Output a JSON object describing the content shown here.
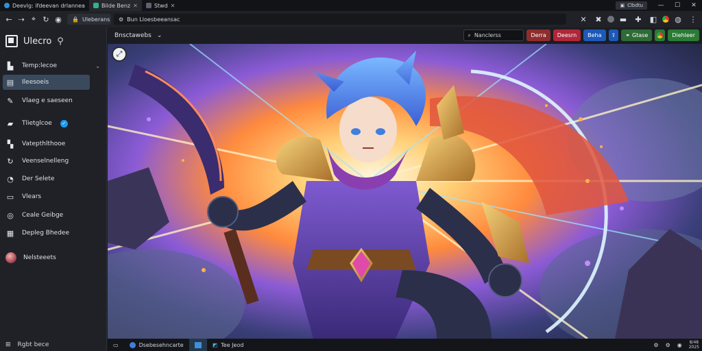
{
  "tabs": [
    {
      "label": "Deevlg: ifdeevan drlannea",
      "active": false
    },
    {
      "label": "Bilde Benz",
      "active": true
    },
    {
      "label": "Stwd",
      "active": false
    }
  ],
  "titlebar": {
    "mini_label": "Clbdtu",
    "mini_icon": "user-icon"
  },
  "address": {
    "short_label": "Uleberans",
    "url": "Bun Lloesbeeansac"
  },
  "sidebar": {
    "brand": "Ulecro",
    "items": [
      {
        "label": "Temp:lecoe",
        "icon": "bookmark-icon",
        "chevron": true
      },
      {
        "label": "Ileesoeis",
        "icon": "document-icon",
        "active": true
      },
      {
        "label": "Vlaeg e saeseen",
        "icon": "pin-icon"
      },
      {
        "label": "Tlietglcoe",
        "icon": "folder-icon",
        "verified": true
      },
      {
        "label": "Vatepthlthooe",
        "icon": "grid-icon"
      },
      {
        "label": "Veenselnelleng",
        "icon": "refresh-icon"
      },
      {
        "label": "Der Selete",
        "icon": "chat-icon"
      },
      {
        "label": "Vlears",
        "icon": "image-icon"
      },
      {
        "label": "Ceale Geibge",
        "icon": "location-icon"
      },
      {
        "label": "Depleg Bhedee",
        "icon": "calendar-icon"
      },
      {
        "label": "Nelsteeets",
        "icon": "avatar"
      }
    ],
    "footer": "Rgbt bece"
  },
  "content": {
    "breadcrumb": "Bnsctawebs",
    "search_placeholder": "Nanclerss",
    "buttons": [
      {
        "label": "Derra",
        "color": "#8e2d2d"
      },
      {
        "label": "Deesrn",
        "color": "#b0263a"
      },
      {
        "label": "Beha",
        "color": "#1c59b8"
      },
      {
        "label": "Gtase",
        "color": "#2e6b37"
      },
      {
        "label": "Diehleer",
        "color": "#2b7a36"
      }
    ]
  },
  "bottom": {
    "tabs": [
      {
        "label": "Dsebesehncarte",
        "active": false
      },
      {
        "label": "",
        "active": true
      },
      {
        "label": "Tee Jeod",
        "active": false
      }
    ],
    "clock_top": "8/48",
    "clock_bottom": "2025"
  }
}
